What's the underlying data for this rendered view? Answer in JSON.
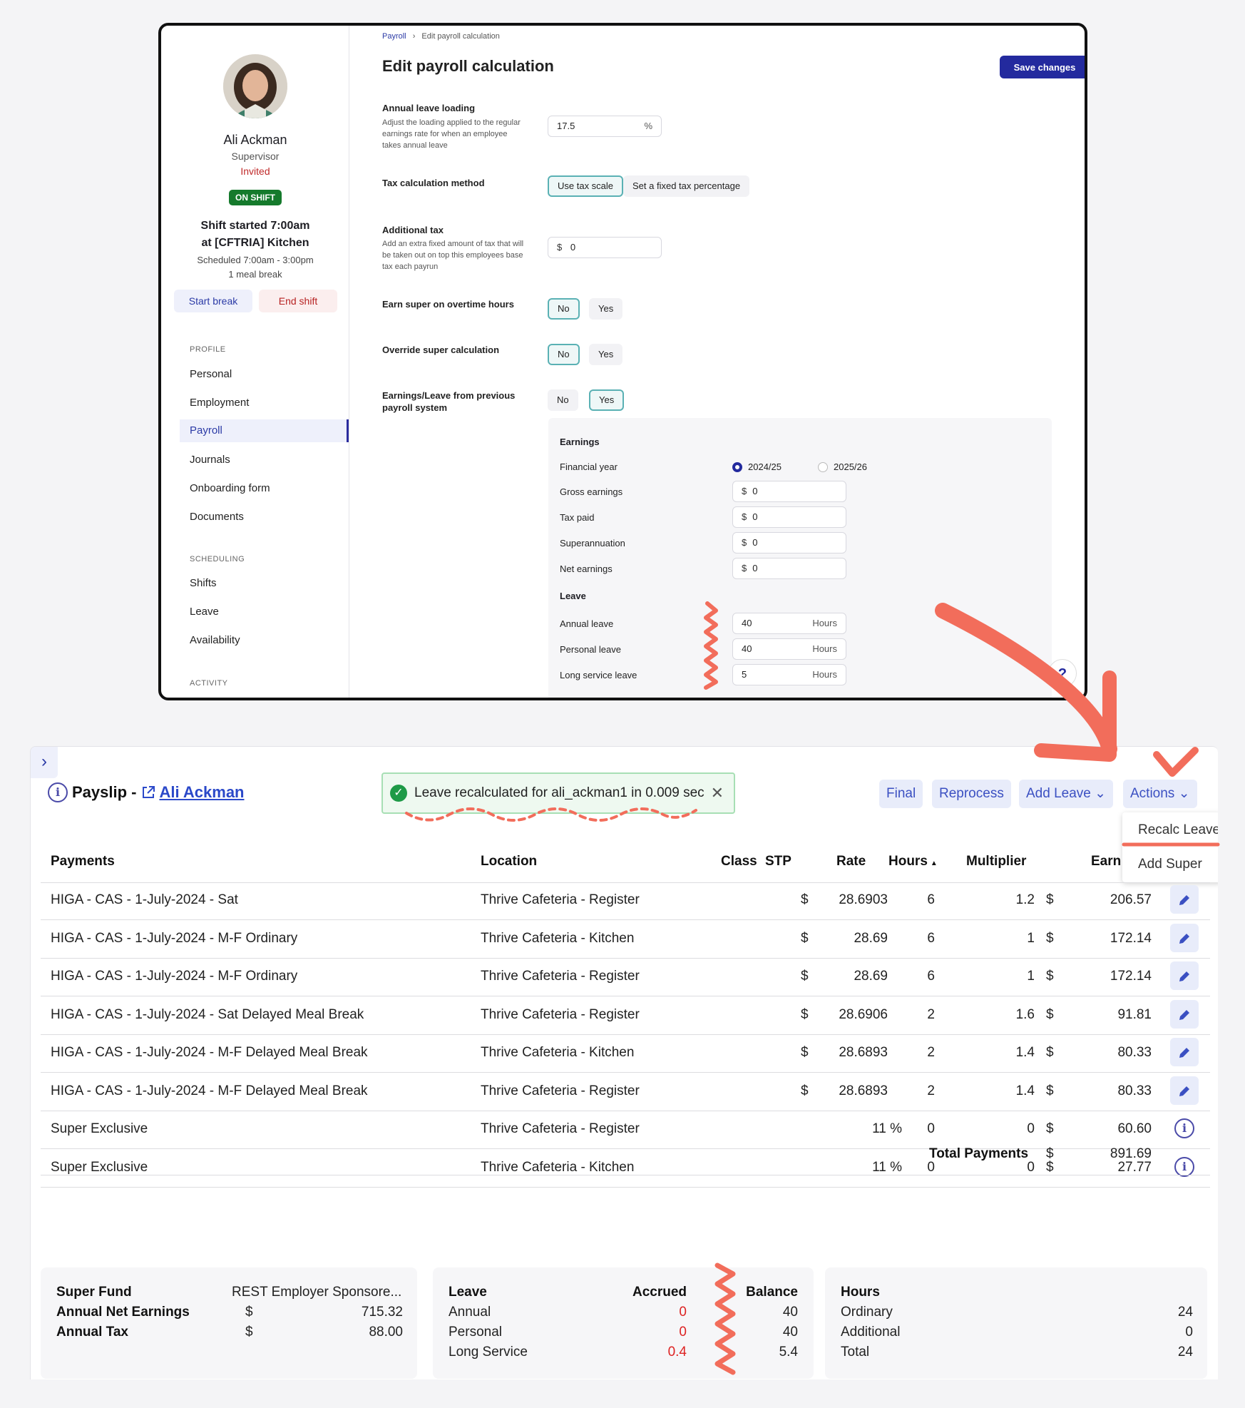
{
  "employee": {
    "name": "Ali Ackman",
    "role": "Supervisor",
    "status": "Invited",
    "shift_badge": "ON SHIFT",
    "shift_started": "Shift started 7:00am",
    "shift_location": "at [CFTRIA] Kitchen",
    "scheduled": "Scheduled 7:00am - 3:00pm",
    "meal_break": "1 meal break",
    "start_break": "Start break",
    "end_shift": "End shift"
  },
  "nav": {
    "profile_heading": "PROFILE",
    "profile_items": [
      "Personal",
      "Employment",
      "Payroll",
      "Journals",
      "Onboarding form",
      "Documents"
    ],
    "scheduling_heading": "SCHEDULING",
    "scheduling_items": [
      "Shifts",
      "Leave",
      "Availability"
    ],
    "activity_heading": "ACTIVITY"
  },
  "editor": {
    "breadcrumb_root": "Payroll",
    "breadcrumb_sep": "›",
    "breadcrumb_current": "Edit payroll calculation",
    "title": "Edit payroll calculation",
    "save_label": "Save changes",
    "close_glyph": "✕",
    "leave_loading_label": "Annual leave loading",
    "leave_loading_desc": "Adjust the loading applied to the regular earnings rate for when an employee takes annual leave",
    "leave_loading_value": "17.5",
    "leave_loading_suffix": "%",
    "tax_method_label": "Tax calculation method",
    "tax_method_options": [
      "Use tax scale",
      "Set a fixed tax percentage"
    ],
    "additional_tax_label": "Additional tax",
    "additional_tax_desc": "Add an extra fixed amount of tax that will be taken out on top this employees base tax each payrun",
    "additional_tax_value": "0",
    "currency": "$",
    "super_overtime_label": "Earn super on overtime hours",
    "override_super_label": "Override super calculation",
    "previous_system_label": "Earnings/Leave from previous payroll system",
    "no": "No",
    "yes": "Yes",
    "earnings_heading": "Earnings",
    "financial_year_label": "Financial year",
    "fy_options": [
      "2024/25",
      "2025/26"
    ],
    "earnings_fields": [
      {
        "label": "Gross earnings",
        "value": "0"
      },
      {
        "label": "Tax paid",
        "value": "0"
      },
      {
        "label": "Superannuation",
        "value": "0"
      },
      {
        "label": "Net earnings",
        "value": "0"
      }
    ],
    "leave_heading": "Leave",
    "hours_suffix": "Hours",
    "leave_fields": [
      {
        "label": "Annual leave",
        "value": "40"
      },
      {
        "label": "Personal leave",
        "value": "40"
      },
      {
        "label": "Long service leave",
        "value": "5"
      }
    ],
    "help_glyph": "?"
  },
  "payslip": {
    "title_prefix": "Payslip -",
    "employee_link": "Ali Ackman",
    "toast": "Leave recalculated for ali_ackman1 in 0.009 sec",
    "buttons": {
      "final": "Final",
      "reprocess": "Reprocess",
      "add_leave": "Add Leave",
      "actions": "Actions"
    },
    "actions_menu": [
      "Recalc Leave",
      "Add Super"
    ],
    "columns": {
      "payments": "Payments",
      "location": "Location",
      "class": "Class",
      "stp": "STP",
      "rate": "Rate",
      "hours": "Hours",
      "multiplier": "Multiplier",
      "earnings": "Earn"
    },
    "rows": [
      {
        "payment": "HIGA - CAS - 1-July-2024 - Sat",
        "location": "Thrive Cafeteria - Register",
        "rate_prefix": "$",
        "rate": "28.6903",
        "hours": "6",
        "multiplier": "1.2",
        "earn_prefix": "$",
        "earnings": "206.57",
        "action": "edit"
      },
      {
        "payment": "HIGA - CAS - 1-July-2024 - M-F Ordinary",
        "location": "Thrive Cafeteria - Kitchen",
        "rate_prefix": "$",
        "rate": "28.69",
        "hours": "6",
        "multiplier": "1",
        "earn_prefix": "$",
        "earnings": "172.14",
        "action": "edit"
      },
      {
        "payment": "HIGA - CAS - 1-July-2024 - M-F Ordinary",
        "location": "Thrive Cafeteria - Register",
        "rate_prefix": "$",
        "rate": "28.69",
        "hours": "6",
        "multiplier": "1",
        "earn_prefix": "$",
        "earnings": "172.14",
        "action": "edit"
      },
      {
        "payment": "HIGA - CAS - 1-July-2024 - Sat Delayed Meal Break",
        "location": "Thrive Cafeteria - Register",
        "rate_prefix": "$",
        "rate": "28.6906",
        "hours": "2",
        "multiplier": "1.6",
        "earn_prefix": "$",
        "earnings": "91.81",
        "action": "edit"
      },
      {
        "payment": "HIGA - CAS - 1-July-2024 - M-F Delayed Meal Break",
        "location": "Thrive Cafeteria - Kitchen",
        "rate_prefix": "$",
        "rate": "28.6893",
        "hours": "2",
        "multiplier": "1.4",
        "earn_prefix": "$",
        "earnings": "80.33",
        "action": "edit"
      },
      {
        "payment": "HIGA - CAS - 1-July-2024 - M-F Delayed Meal Break",
        "location": "Thrive Cafeteria - Register",
        "rate_prefix": "$",
        "rate": "28.6893",
        "hours": "2",
        "multiplier": "1.4",
        "earn_prefix": "$",
        "earnings": "80.33",
        "action": "edit"
      },
      {
        "payment": "Super Exclusive",
        "location": "Thrive Cafeteria - Register",
        "rate_prefix": "",
        "rate": "11 %",
        "hours": "0",
        "multiplier": "0",
        "earn_prefix": "$",
        "earnings": "60.60",
        "action": "info"
      },
      {
        "payment": "Super Exclusive",
        "location": "Thrive Cafeteria - Kitchen",
        "rate_prefix": "",
        "rate": "11 %",
        "hours": "0",
        "multiplier": "0",
        "earn_prefix": "$",
        "earnings": "27.77",
        "action": "info"
      }
    ],
    "total_label": "Total Payments",
    "total_prefix": "$",
    "total_value": "891.69",
    "super_card": {
      "super_fund_label": "Super Fund",
      "super_fund_value": "REST Employer Sponsore...",
      "net_label": "Annual Net Earnings",
      "net_prefix": "$",
      "net_value": "715.32",
      "tax_label": "Annual Tax",
      "tax_prefix": "$",
      "tax_value": "88.00"
    },
    "leave_card": {
      "heading": "Leave",
      "accrued_heading": "Accrued",
      "balance_heading": "Balance",
      "rows": [
        {
          "label": "Annual",
          "accrued": "0",
          "balance": "40"
        },
        {
          "label": "Personal",
          "accrued": "0",
          "balance": "40"
        },
        {
          "label": "Long Service",
          "accrued": "0.4",
          "balance": "5.4"
        }
      ]
    },
    "hours_card": {
      "heading": "Hours",
      "rows": [
        {
          "label": "Ordinary",
          "value": "24"
        },
        {
          "label": "Additional",
          "value": "0"
        },
        {
          "label": "Total",
          "value": "24"
        }
      ]
    }
  },
  "colors": {
    "accent": "#232a9e",
    "link": "#2b49c9",
    "success": "#1e9a47",
    "annotation": "#f26d5b"
  },
  "icons": {
    "expand": "chevron-right-icon",
    "edit": "pencil-icon",
    "info": "info-icon",
    "check": "check-circle-icon",
    "external": "external-link-icon"
  }
}
